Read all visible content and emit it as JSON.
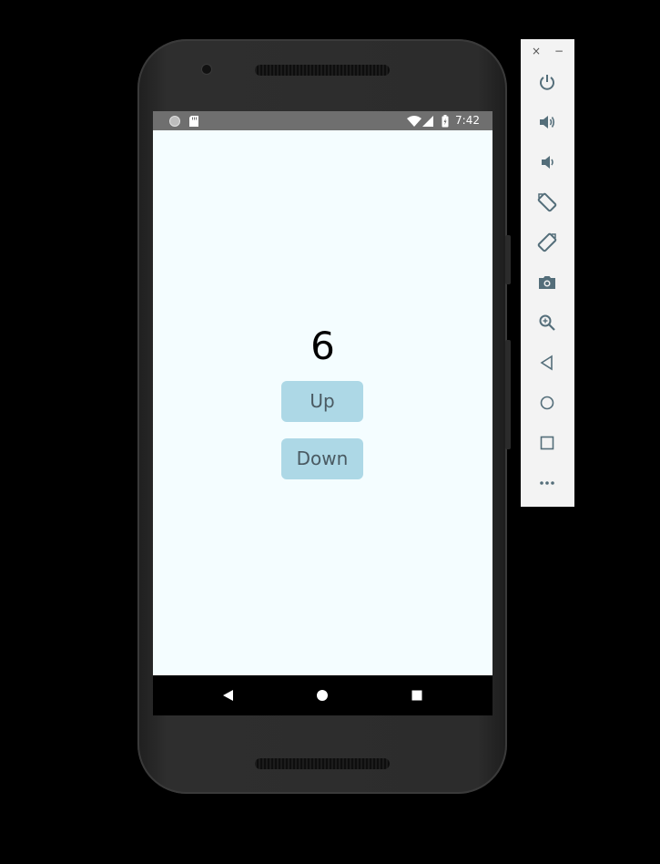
{
  "status_bar": {
    "time": "7:42",
    "icons": [
      "circle-notification-icon",
      "sd-card-icon",
      "wifi-icon",
      "signal-icon",
      "battery-charging-icon"
    ]
  },
  "app": {
    "background": "#f4fdff",
    "counter_value": "6",
    "up_button": "Up",
    "down_button": "Down",
    "button_color": "#add8e6"
  },
  "nav_bar": {
    "items": [
      "back-icon",
      "home-icon",
      "recents-icon"
    ]
  },
  "emulator_toolbar": {
    "close": "×",
    "minimize": "−",
    "items": [
      "power-icon",
      "volume-up-icon",
      "volume-down-icon",
      "rotate-left-icon",
      "rotate-right-icon",
      "screenshot-icon",
      "zoom-icon",
      "back-icon",
      "home-icon",
      "overview-icon",
      "more-icon"
    ]
  }
}
